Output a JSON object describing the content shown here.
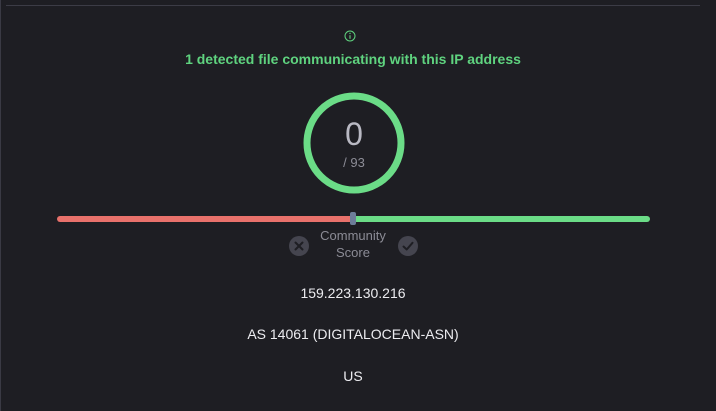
{
  "detection": {
    "message": "1 detected file communicating with this IP address"
  },
  "score": {
    "value": "0",
    "total": "/ 93"
  },
  "community": {
    "label_line1": "Community",
    "label_line2": "Score"
  },
  "ip_info": {
    "address": "159.223.130.216",
    "asn": "AS 14061 (DIGITALOCEAN-ASN)",
    "country": "US"
  },
  "colors": {
    "accent_green": "#5fd37f",
    "negative_red": "#e8716b",
    "background": "#1e1e23"
  },
  "icons": {
    "info": "info-icon",
    "vote_down": "close-icon",
    "vote_up": "check-icon"
  }
}
